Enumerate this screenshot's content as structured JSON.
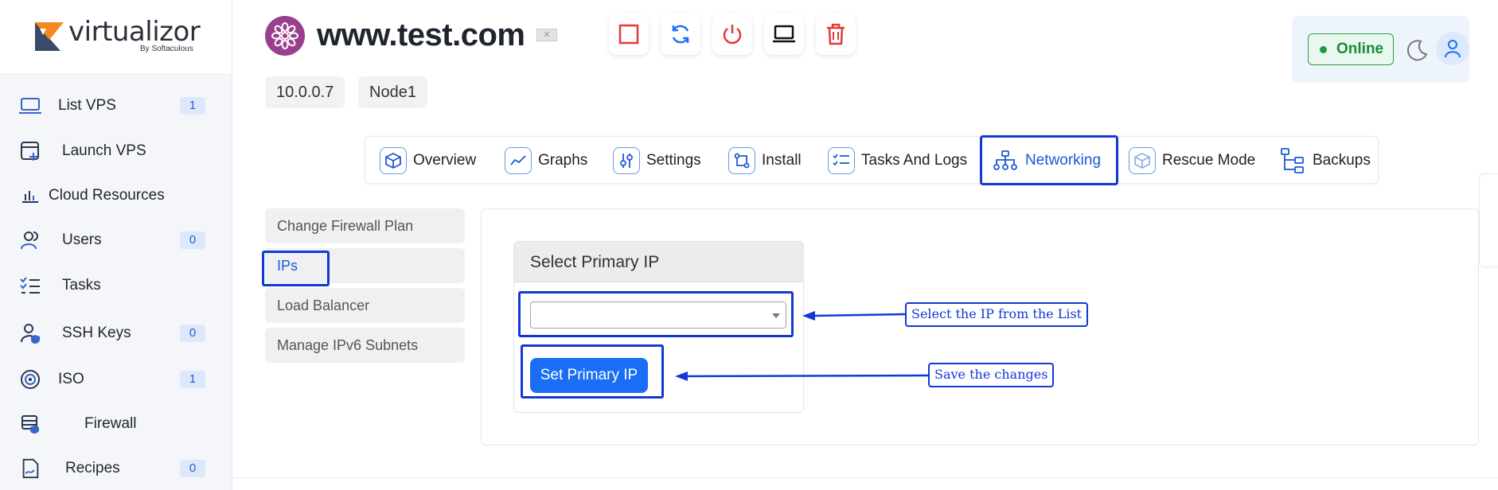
{
  "brand": {
    "name": "virtualizor",
    "sub": "By Softaculous"
  },
  "sidebar": {
    "items": [
      {
        "label": "List VPS",
        "badge": "1",
        "icon": "laptop-icon"
      },
      {
        "label": "Launch VPS",
        "badge": "",
        "icon": "launch-icon"
      },
      {
        "label": "Cloud Resources",
        "badge": "",
        "icon": "chart-icon"
      },
      {
        "label": "Users",
        "badge": "0",
        "icon": "users-icon"
      },
      {
        "label": "Tasks",
        "badge": "",
        "icon": "tasks-icon"
      },
      {
        "label": "SSH Keys",
        "badge": "0",
        "icon": "key-user-icon"
      },
      {
        "label": "ISO",
        "badge": "1",
        "icon": "disc-icon"
      },
      {
        "label": "Firewall",
        "badge": "",
        "icon": "firewall-icon"
      },
      {
        "label": "Recipes",
        "badge": "0",
        "icon": "recipe-icon"
      }
    ]
  },
  "header": {
    "title": "www.test.com",
    "ip": "10.0.0.7",
    "node": "Node1",
    "status": "Online"
  },
  "tabs": [
    {
      "label": "Overview",
      "icon": "cube-icon"
    },
    {
      "label": "Graphs",
      "icon": "graph-icon"
    },
    {
      "label": "Settings",
      "icon": "sliders-icon"
    },
    {
      "label": "Install",
      "icon": "install-icon"
    },
    {
      "label": "Tasks And Logs",
      "icon": "checklist-icon"
    },
    {
      "label": "Networking",
      "icon": "network-icon"
    },
    {
      "label": "Rescue Mode",
      "icon": "rescue-icon"
    },
    {
      "label": "Backups",
      "icon": "backup-icon"
    }
  ],
  "submenu": [
    {
      "label": "Change Firewall Plan"
    },
    {
      "label": "IPs"
    },
    {
      "label": "Load Balancer"
    },
    {
      "label": "Manage IPv6 Subnets"
    }
  ],
  "card": {
    "title": "Select Primary IP",
    "select_value": "",
    "button": "Set Primary IP"
  },
  "callouts": {
    "select": "Select the IP from the List",
    "save": "Save the changes"
  },
  "colors": {
    "accent": "#1a6ef5",
    "annotation": "#1238d6",
    "online": "#1e9a3f",
    "danger": "#e53935"
  }
}
